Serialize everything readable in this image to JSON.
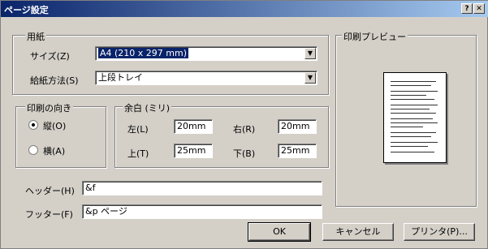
{
  "window": {
    "title": "ページ設定"
  },
  "titlebar": {
    "help_label": "?",
    "close_label": "✕"
  },
  "paper": {
    "group_label": "用紙",
    "size_label": "サイズ(Z)",
    "size_value": "A4 (210 x 297 mm)",
    "source_label": "給紙方法(S)",
    "source_value": "上段トレイ"
  },
  "orientation": {
    "group_label": "印刷の向き",
    "portrait_label": "縦(O)",
    "landscape_label": "横(A)",
    "selected": "portrait"
  },
  "margins": {
    "group_label": "余白 (ミリ)",
    "left_label": "左(L)",
    "left_value": "20mm",
    "right_label": "右(R)",
    "right_value": "20mm",
    "top_label": "上(T)",
    "top_value": "25mm",
    "bottom_label": "下(B)",
    "bottom_value": "25mm"
  },
  "header": {
    "label": "ヘッダー(H)",
    "value": "&f"
  },
  "footer": {
    "label": "フッター(F)",
    "value": "&p ページ"
  },
  "preview": {
    "group_label": "印刷プレビュー"
  },
  "buttons": {
    "ok": "OK",
    "cancel": "キャンセル",
    "printer": "プリンタ(P)..."
  },
  "colors": {
    "title_start": "#0a246a",
    "title_end": "#a6caf0",
    "face": "#d4d0c8",
    "selection": "#0a246a"
  },
  "icons": {
    "dropdown": "chevron-down-icon"
  }
}
